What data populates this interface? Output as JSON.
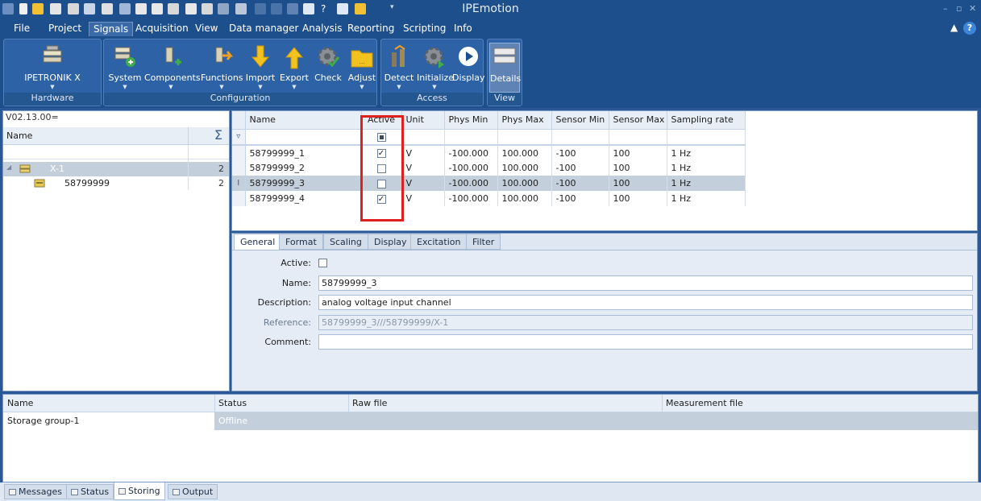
{
  "window": {
    "title": "IPEmotion"
  },
  "menu": {
    "items": [
      "File",
      "Project",
      "Signals",
      "Acquisition",
      "View",
      "Data manager",
      "Analysis",
      "Reporting",
      "Scripting",
      "Info"
    ],
    "active": "Signals"
  },
  "ribbon": {
    "groups": [
      {
        "label": "Hardware",
        "buttons": [
          {
            "label": "IPETRONIK X",
            "icon": "hardware-device-icon"
          }
        ]
      },
      {
        "label": "Configuration",
        "buttons": [
          {
            "label": "System",
            "icon": "system-add-icon"
          },
          {
            "label": "Components",
            "icon": "components-add-icon"
          },
          {
            "label": "Functions",
            "icon": "functions-icon"
          },
          {
            "label": "Import",
            "icon": "import-arrow-icon"
          },
          {
            "label": "Export",
            "icon": "export-arrow-icon"
          },
          {
            "label": "Check",
            "icon": "check-gear-icon"
          },
          {
            "label": "Adjust",
            "icon": "adjust-folder-icon"
          }
        ]
      },
      {
        "label": "Access",
        "buttons": [
          {
            "label": "Detect",
            "icon": "detect-icon"
          },
          {
            "label": "Initialize",
            "icon": "initialize-gear-icon"
          },
          {
            "label": "Display",
            "icon": "play-icon"
          }
        ]
      },
      {
        "label": "View",
        "buttons": [
          {
            "label": "Details",
            "icon": "details-list-icon"
          }
        ]
      }
    ]
  },
  "tree": {
    "version": "V02.13.00=",
    "header_name": "Name",
    "header_sum": "Σ",
    "nodes": [
      {
        "label": "X-1",
        "count": "2"
      },
      {
        "label": "58799999",
        "count": "2"
      }
    ]
  },
  "signals_grid": {
    "columns": [
      "Name",
      "Active",
      "Unit",
      "Phys Min",
      "Phys Max",
      "Sensor Min",
      "Sensor Max",
      "Sampling rate"
    ],
    "rows": [
      {
        "name": "58799999_1",
        "active": true,
        "unit": "V",
        "phys_min": "-100.000",
        "phys_max": "100.000",
        "sensor_min": "-100",
        "sensor_max": "100",
        "rate": "1 Hz"
      },
      {
        "name": "58799999_2",
        "active": false,
        "unit": "V",
        "phys_min": "-100.000",
        "phys_max": "100.000",
        "sensor_min": "-100",
        "sensor_max": "100",
        "rate": "1 Hz"
      },
      {
        "name": "58799999_3",
        "active": false,
        "unit": "V",
        "phys_min": "-100.000",
        "phys_max": "100.000",
        "sensor_min": "-100",
        "sensor_max": "100",
        "rate": "1 Hz"
      },
      {
        "name": "58799999_4",
        "active": true,
        "unit": "V",
        "phys_min": "-100.000",
        "phys_max": "100.000",
        "sensor_min": "-100",
        "sensor_max": "100",
        "rate": "1 Hz"
      }
    ],
    "selected_row": 2,
    "highlight_color": "#e0201e"
  },
  "detail_tabs": [
    "General",
    "Format",
    "Scaling",
    "Display",
    "Excitation",
    "Filter"
  ],
  "general_form": {
    "active_label": "Active:",
    "name_label": "Name:",
    "name_value": "58799999_3",
    "description_label": "Description:",
    "description_value": "analog voltage input channel",
    "reference_label": "Reference:",
    "reference_value": "58799999_3///58799999/X-1",
    "comment_label": "Comment:",
    "comment_value": ""
  },
  "storage": {
    "columns": [
      "Name",
      "Status",
      "Raw file",
      "Measurement file"
    ],
    "row": {
      "name": "Storage group-1",
      "status": "Offline"
    }
  },
  "bottom_tabs": [
    "Messages",
    "Status",
    "Storing",
    "Output"
  ],
  "bottom_active": "Storing",
  "colors": {
    "accent": "#1d4f8c",
    "ribbon": "#2d62a6",
    "selection": "#c4cfdc"
  }
}
